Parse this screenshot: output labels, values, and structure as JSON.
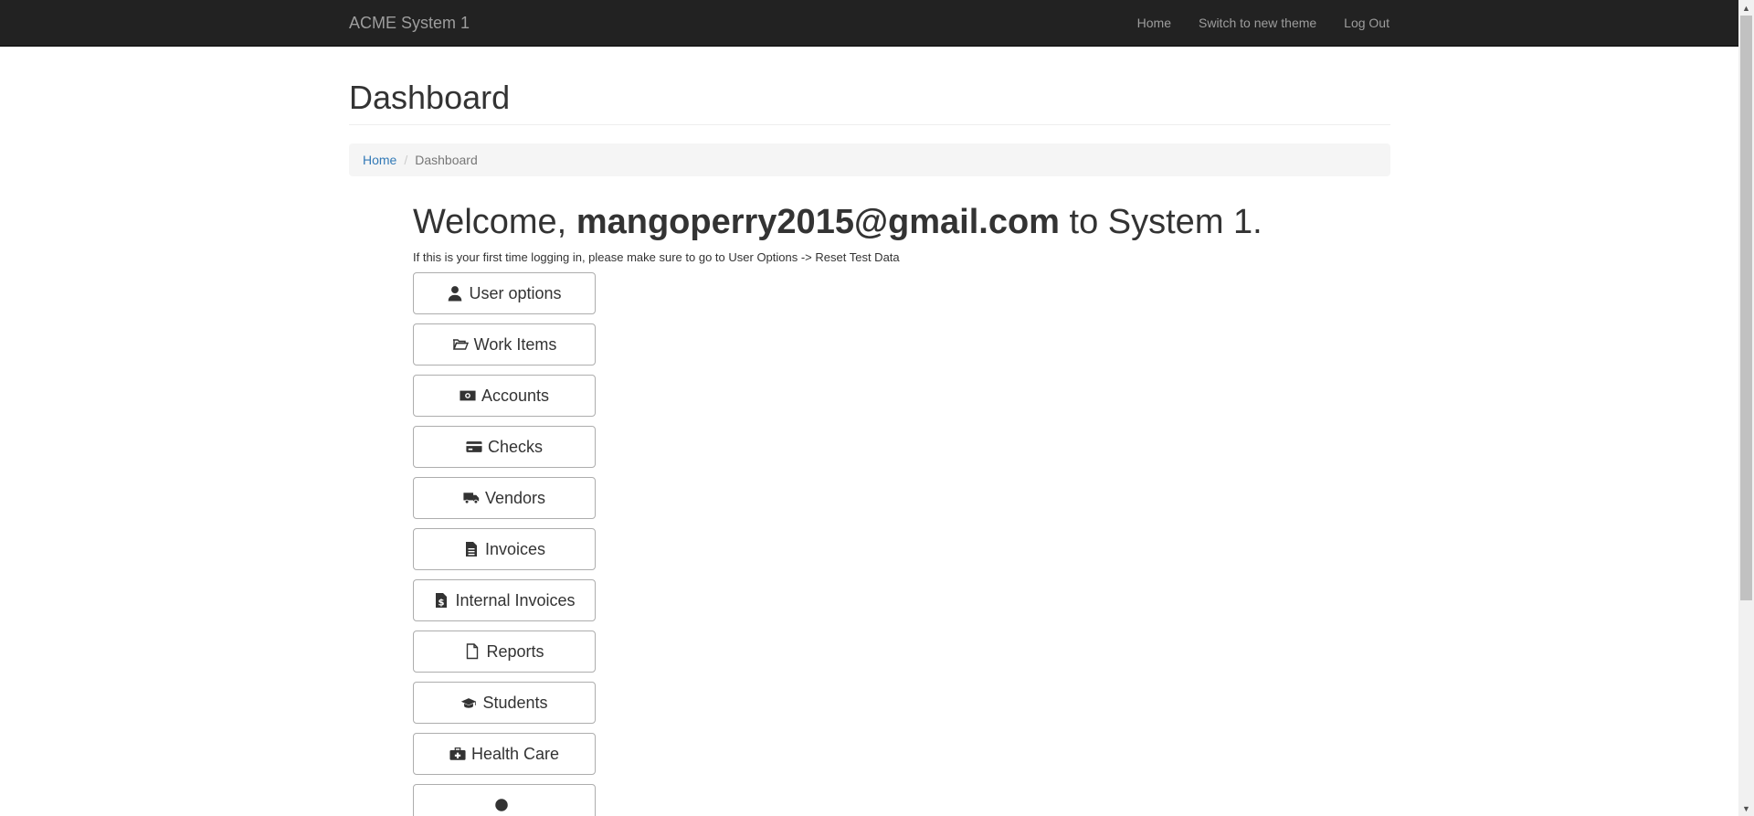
{
  "navbar": {
    "brand": "ACME System 1",
    "links": [
      "Home",
      "Switch to new theme",
      "Log Out"
    ]
  },
  "header": {
    "title": "Dashboard"
  },
  "breadcrumb": {
    "home": "Home",
    "separator": "/",
    "current": "Dashboard"
  },
  "welcome": {
    "prefix": "Welcome,",
    "email": "mangoperry2015@gmail.com",
    "suffix": "to System 1.",
    "note": "If this is your first time logging in, please make sure to go to User Options -> Reset Test Data"
  },
  "menu": [
    {
      "label": "User options",
      "icon": "user-icon"
    },
    {
      "label": "Work Items",
      "icon": "folder-open-icon"
    },
    {
      "label": "Accounts",
      "icon": "money-icon"
    },
    {
      "label": "Checks",
      "icon": "credit-card-icon"
    },
    {
      "label": "Vendors",
      "icon": "truck-icon"
    },
    {
      "label": "Invoices",
      "icon": "file-text-icon"
    },
    {
      "label": "Internal Invoices",
      "icon": "file-dollar-icon"
    },
    {
      "label": "Reports",
      "icon": "file-o-icon"
    },
    {
      "label": "Students",
      "icon": "graduation-cap-icon"
    },
    {
      "label": "Health Care",
      "icon": "medkit-icon"
    },
    {
      "label": "",
      "icon": "partial-icon"
    }
  ],
  "colors": {
    "navbar_bg": "#222222",
    "nav_text": "#9d9d9d",
    "link": "#337ab7",
    "breadcrumb_bg": "#f5f5f5"
  }
}
